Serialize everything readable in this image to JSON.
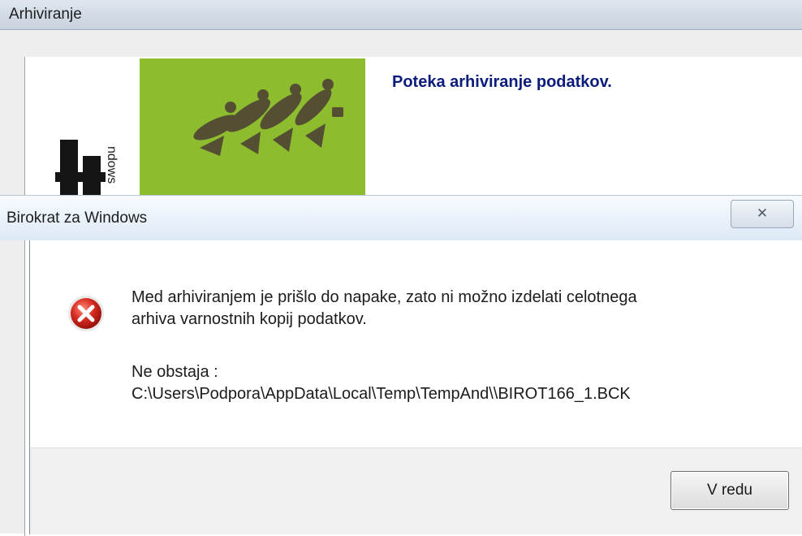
{
  "background_window": {
    "title": "Arhiviranje",
    "heading": "Poteka arhiviranje podatkov.",
    "logo": {
      "big_text": "at",
      "vertical_text": "ndows"
    }
  },
  "dialog": {
    "title": "Birokrat za Windows",
    "close_icon": "close-icon",
    "error_icon": "error-icon",
    "message_line1": "Med arhiviranjem je prišlo do napake, zato ni možno izdelati celotnega",
    "message_line2": "arhiva varnostnih kopij podatkov.",
    "detail_label": "Ne obstaja :",
    "detail_path": "C:\\Users\\Podpora\\AppData\\Local\\Temp\\TempAnd\\\\BIROT166_1.BCK",
    "ok_label": "V redu"
  },
  "colors": {
    "heading": "#0b1c7a",
    "logo_green": "#8ebc2f",
    "error_red": "#c8201a"
  }
}
